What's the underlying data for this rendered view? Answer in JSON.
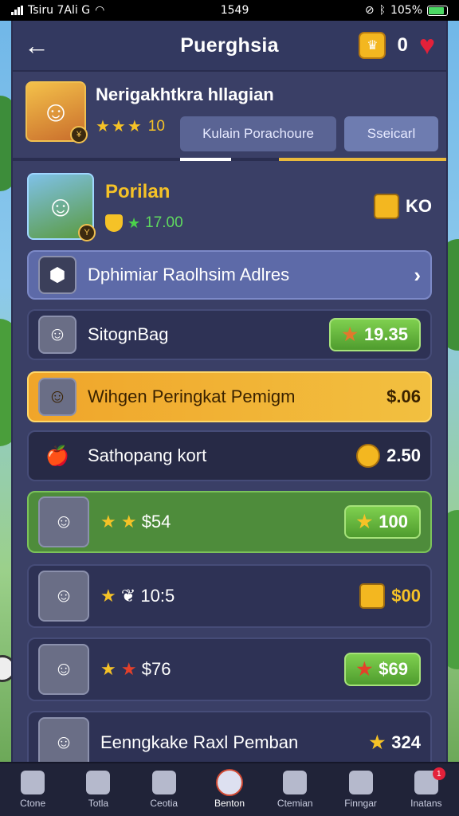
{
  "status_bar": {
    "carrier": "Tsiru 7Ali G",
    "time": "1549",
    "battery": "105%"
  },
  "header": {
    "back_icon": "arrow-left-icon",
    "title": "Puerghsia",
    "crown_count": "0"
  },
  "profile": {
    "name": "Nerigakhtkra hllagian",
    "stars": "★★★",
    "rating": "10"
  },
  "tabs": [
    {
      "label": "Kulain Porachoure"
    },
    {
      "label": "Sseicarl"
    }
  ],
  "featured": {
    "name": "Porilan",
    "value": "17.00",
    "reward": "KO"
  },
  "rows": [
    {
      "label": "Dphimiar Raolhsim Adlres"
    },
    {
      "label": "SitognBag",
      "price": "19.35"
    },
    {
      "label": "Wihgen Peringkat Pemigm",
      "price": "$.06"
    },
    {
      "label": "Sathopang kort",
      "price": "2.50"
    },
    {
      "value": "$54",
      "price": "100"
    },
    {
      "value": "10:5",
      "price": "$00"
    },
    {
      "value": "$76",
      "price": "$69"
    },
    {
      "label": "Eenngkake Raxl Pemban",
      "price": "324"
    }
  ],
  "nav": [
    {
      "label": "Ctone",
      "icon": "home-icon"
    },
    {
      "label": "Totla",
      "icon": "search-icon"
    },
    {
      "label": "Ceotia",
      "icon": "trophy-icon"
    },
    {
      "label": "Benton",
      "icon": "bag-icon"
    },
    {
      "label": "Ctemian",
      "icon": "gear-icon"
    },
    {
      "label": "Finngar",
      "icon": "info-icon"
    },
    {
      "label": "Inatans",
      "icon": "mail-icon",
      "badge": "1"
    }
  ]
}
